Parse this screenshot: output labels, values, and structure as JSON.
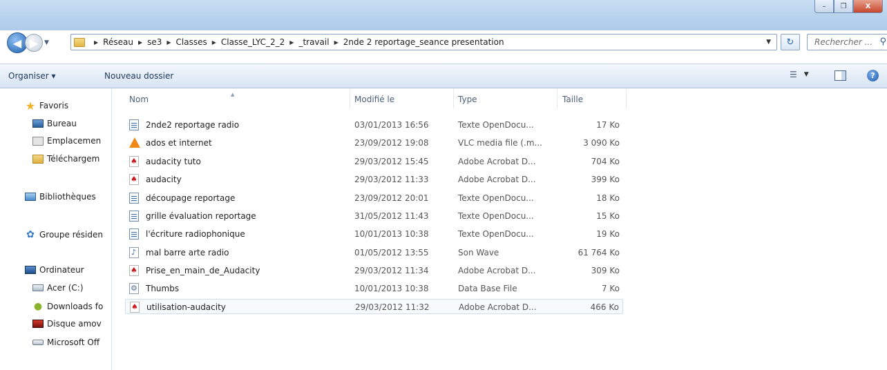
{
  "window": {
    "controls": {
      "minimize": "–",
      "maximize": "❐",
      "close": "X"
    }
  },
  "address_bar": {
    "breadcrumbs": [
      "Réseau",
      "se3",
      "Classes",
      "Classe_LYC_2_2",
      "_travail",
      "2nde 2 reportage_seance presentation"
    ]
  },
  "search": {
    "placeholder": "Rechercher ..."
  },
  "toolbar": {
    "organize_label": "Organiser ▾",
    "new_folder_label": "Nouveau dossier",
    "help_label": "?"
  },
  "sidebar": {
    "favorites": {
      "label": "Favoris",
      "icon": "star-icon"
    },
    "favorite_items": [
      {
        "label": "Bureau",
        "icon": "desktop-icon"
      },
      {
        "label": "Emplacemen",
        "icon": "recent-places-icon"
      },
      {
        "label": "Téléchargem",
        "icon": "downloads-folder-icon"
      }
    ],
    "libraries": {
      "label": "Bibliothèques",
      "icon": "libraries-icon"
    },
    "homegroup": {
      "label": "Groupe résiden",
      "icon": "homegroup-icon"
    },
    "computer": {
      "label": "Ordinateur",
      "icon": "computer-icon"
    },
    "computer_items": [
      {
        "label": "Acer (C:)",
        "icon": "drive-icon"
      },
      {
        "label": "Downloads fo",
        "icon": "android-icon"
      },
      {
        "label": "Disque amov",
        "icon": "removable-disk-icon"
      },
      {
        "label": "Microsoft Off",
        "icon": "drive-icon"
      }
    ]
  },
  "file_list": {
    "columns": [
      "Nom",
      "Modifié le",
      "Type",
      "Taille"
    ],
    "sorted_by": "Nom",
    "rows": [
      {
        "name": "2nde2 reportage radio",
        "modified": "03/01/2013 16:56",
        "type": "Texte OpenDocu...",
        "size": "17 Ko",
        "icon": "odt-file-icon"
      },
      {
        "name": "ados et internet",
        "modified": "23/09/2012 19:08",
        "type": "VLC media file (.m...",
        "size": "3 090 Ko",
        "icon": "vlc-file-icon"
      },
      {
        "name": "audacity tuto",
        "modified": "29/03/2012 15:45",
        "type": "Adobe Acrobat D...",
        "size": "704 Ko",
        "icon": "pdf-file-icon"
      },
      {
        "name": "audacity",
        "modified": "29/03/2012 11:33",
        "type": "Adobe Acrobat D...",
        "size": "399 Ko",
        "icon": "pdf-file-icon"
      },
      {
        "name": "découpage reportage",
        "modified": "23/09/2012 20:01",
        "type": "Texte OpenDocu...",
        "size": "18 Ko",
        "icon": "odt-file-icon"
      },
      {
        "name": "grille évaluation reportage",
        "modified": "31/05/2012 11:43",
        "type": "Texte OpenDocu...",
        "size": "15 Ko",
        "icon": "odt-file-icon"
      },
      {
        "name": "l'écriture radiophonique",
        "modified": "10/01/2013 10:38",
        "type": "Texte OpenDocu...",
        "size": "19 Ko",
        "icon": "odt-file-icon"
      },
      {
        "name": "mal barre arte radio",
        "modified": "01/05/2012 13:55",
        "type": "Son Wave",
        "size": "61 764 Ko",
        "icon": "wave-file-icon"
      },
      {
        "name": "Prise_en_main_de_Audacity",
        "modified": "29/03/2012 11:34",
        "type": "Adobe Acrobat D...",
        "size": "309 Ko",
        "icon": "pdf-file-icon"
      },
      {
        "name": "Thumbs",
        "modified": "10/01/2013 10:38",
        "type": "Data Base File",
        "size": "7 Ko",
        "icon": "database-file-icon"
      },
      {
        "name": "utilisation-audacity",
        "modified": "29/03/2012 11:32",
        "type": "Adobe Acrobat D...",
        "size": "466 Ko",
        "icon": "pdf-file-icon",
        "selected": true
      }
    ]
  }
}
